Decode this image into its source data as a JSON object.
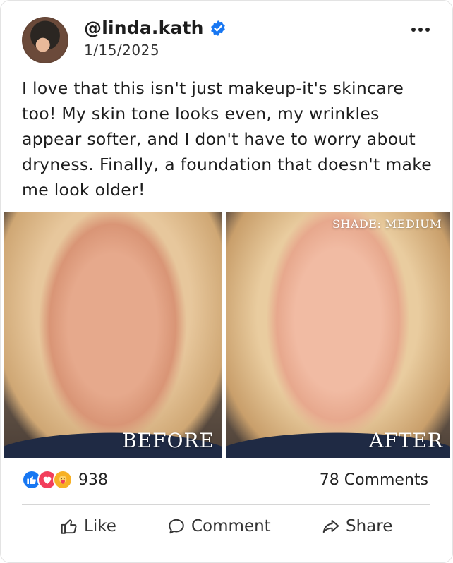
{
  "post": {
    "handle": "@linda.kath",
    "date": "1/15/2025",
    "text": "I love that this isn't just makeup-it's skincare too! My skin tone looks even, my wrinkles appear softer, and I don't have to worry about dryness. Finally, a foundation that doesn't make me look older!",
    "verified": true
  },
  "media": {
    "before_label": "BEFORE",
    "after_label": "AFTER",
    "shade_label": "SHADE: MEDIUM"
  },
  "stats": {
    "reaction_count": "938",
    "comments_label": "78 Comments",
    "reactions": [
      "like-icon",
      "love-icon",
      "care-icon"
    ]
  },
  "actions": {
    "like": "Like",
    "comment": "Comment",
    "share": "Share"
  },
  "colors": {
    "verified_blue": "#1877f2",
    "like_blue": "#1877f2",
    "love_red": "#f23e5b",
    "care_yellow": "#f7b125"
  }
}
